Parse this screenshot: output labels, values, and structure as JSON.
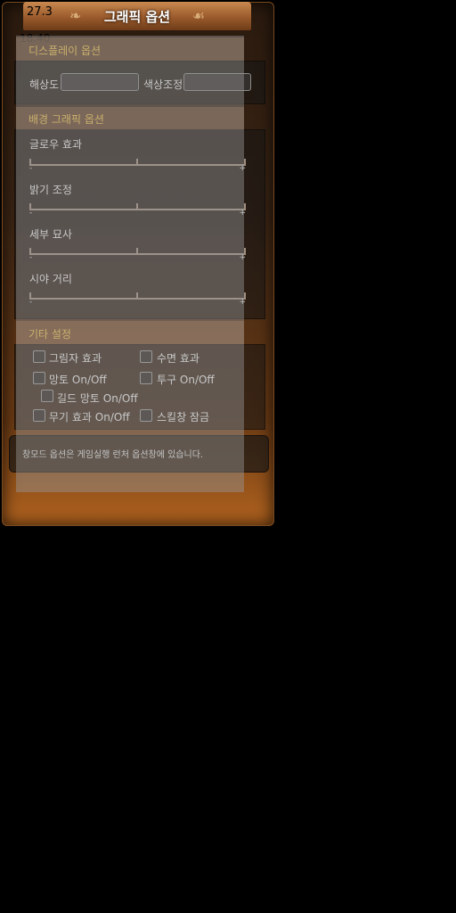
{
  "debug": {
    "fps": "27.3",
    "ms": "18.40"
  },
  "window": {
    "title": "그래픽 옵션"
  },
  "display_section": {
    "header": "디스플레이 옵션",
    "resolution_label": "해상도",
    "resolution_value": "",
    "color_label": "색상조정",
    "color_value": ""
  },
  "background_section": {
    "header": "배경 그래픽 옵션",
    "sliders": [
      {
        "label": "글로우 효과",
        "min_symbol": "-",
        "max_symbol": "+"
      },
      {
        "label": "밝기 조정",
        "min_symbol": "-",
        "max_symbol": "+"
      },
      {
        "label": "세부 묘사",
        "min_symbol": "-",
        "max_symbol": "+"
      },
      {
        "label": "시야 거리",
        "min_symbol": "-",
        "max_symbol": "+"
      }
    ]
  },
  "misc_section": {
    "header": "기타 설정",
    "checkboxes": {
      "shadow": "그림자 효과",
      "water": "수면 효과",
      "cape": "망토 On/Off",
      "helmet": "투구 On/Off",
      "guild_cape": "길드 망토 On/Off",
      "weapon_effect": "무기 효과 On/Off",
      "skill_lock": "스킬창 잠금"
    }
  },
  "note": {
    "text": "창모드 옵션은 게임실행 런처 옵션창에 있습니다."
  }
}
